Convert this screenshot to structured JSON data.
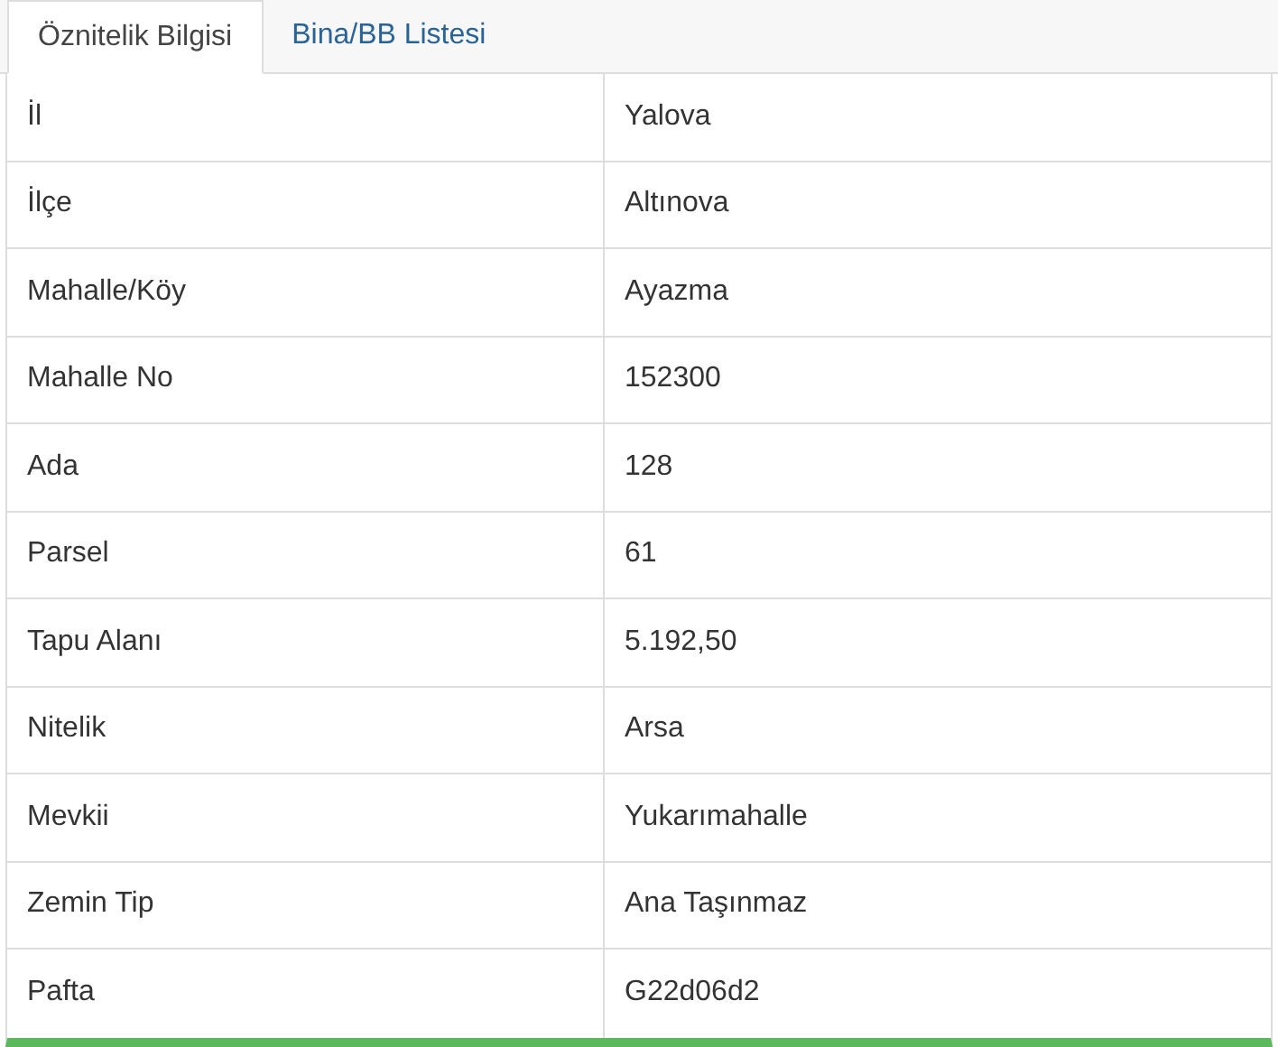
{
  "tabs": [
    {
      "label": "Öznitelik Bilgisi",
      "selected": true
    },
    {
      "label": "Bina/BB Listesi",
      "selected": false
    }
  ],
  "table": {
    "rows": [
      {
        "label": "İl",
        "value": "Yalova"
      },
      {
        "label": "İlçe",
        "value": "Altınova"
      },
      {
        "label": "Mahalle/Köy",
        "value": "Ayazma"
      },
      {
        "label": "Mahalle No",
        "value": "152300"
      },
      {
        "label": "Ada",
        "value": "128"
      },
      {
        "label": "Parsel",
        "value": "61"
      },
      {
        "label": "Tapu Alanı",
        "value": "5.192,50"
      },
      {
        "label": "Nitelik",
        "value": "Arsa"
      },
      {
        "label": "Mevkii",
        "value": "Yukarımahalle"
      },
      {
        "label": "Zemin Tip",
        "value": "Ana Taşınmaz"
      },
      {
        "label": "Pafta",
        "value": "G22d06d2"
      }
    ]
  }
}
